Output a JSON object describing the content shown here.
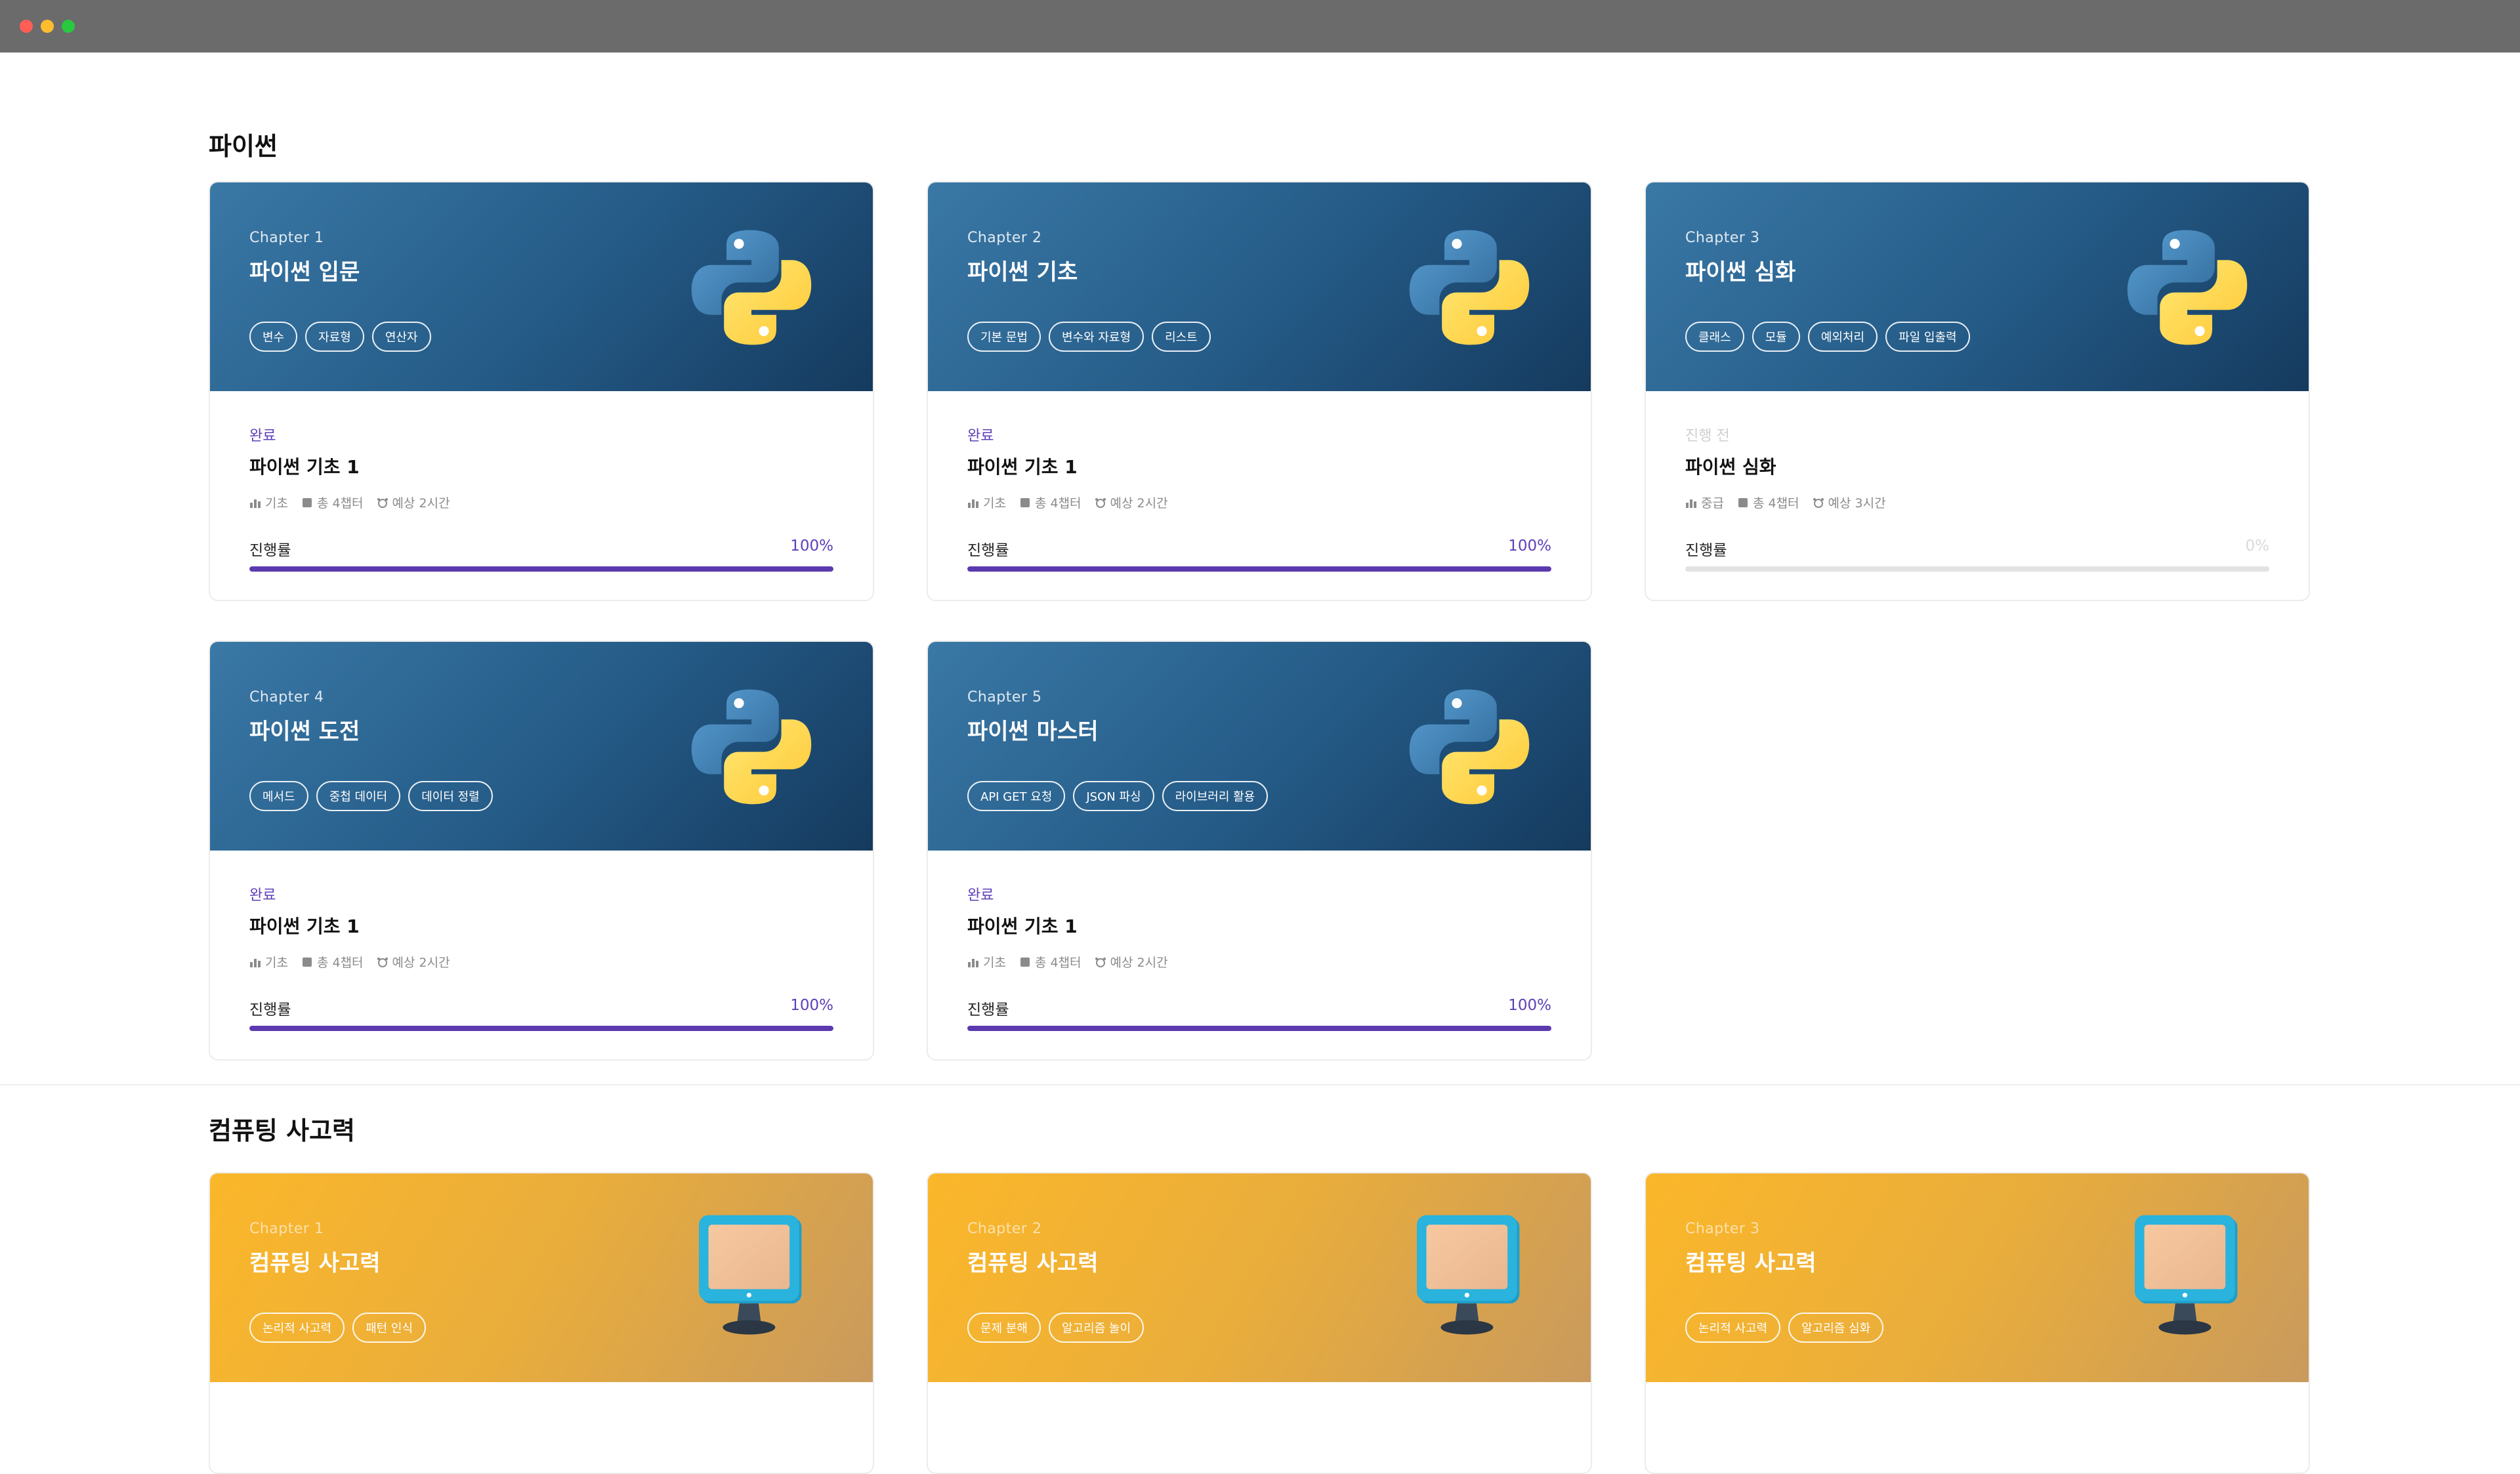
{
  "sections": [
    {
      "title": "파이썬",
      "cards": [
        {
          "chapter": "Chapter 1",
          "title": "파이썬 입문",
          "tags": [
            "변수",
            "자료형",
            "연산자"
          ],
          "status": "완료",
          "body_title": "파이썬 기초 1",
          "level": "기초",
          "chapters": "총 4챕터",
          "time": "예상 2시간",
          "progress_label": "진행률",
          "progress_text": "100%",
          "progress": 1.0
        },
        {
          "chapter": "Chapter 2",
          "title": "파이썬 기초",
          "tags": [
            "기본 문법",
            "변수와 자료형",
            "리스트"
          ],
          "status": "완료",
          "body_title": "파이썬 기초 1",
          "level": "기초",
          "chapters": "총 4챕터",
          "time": "예상 2시간",
          "progress_label": "진행률",
          "progress_text": "100%",
          "progress": 1.0
        },
        {
          "chapter": "Chapter 3",
          "title": "파이썬 심화",
          "tags": [
            "클래스",
            "모듈",
            "예외처리",
            "파일 입출력"
          ],
          "status": "진행 전",
          "body_title": "파이썬 심화",
          "level": "중급",
          "chapters": "총 4챕터",
          "time": "예상 3시간",
          "progress_label": "진행률",
          "progress_text": "0%",
          "progress": 0.0
        },
        {
          "chapter": "Chapter 4",
          "title": "파이썬 도전",
          "tags": [
            "메서드",
            "중첩 데이터",
            "데이터 정렬"
          ],
          "status": "완료",
          "body_title": "파이썬 기초 1",
          "level": "기초",
          "chapters": "총 4챕터",
          "time": "예상 2시간",
          "progress_label": "진행률",
          "progress_text": "100%",
          "progress": 1.0
        },
        {
          "chapter": "Chapter 5",
          "title": "파이썬 마스터",
          "tags": [
            "API GET 요청",
            "JSON 파싱",
            "라이브러리 활용"
          ],
          "status": "완료",
          "body_title": "파이썬 기초 1",
          "level": "기초",
          "chapters": "총 4챕터",
          "time": "예상 2시간",
          "progress_label": "진행률",
          "progress_text": "100%",
          "progress": 1.0
        }
      ]
    },
    {
      "title": "컴퓨팅 사고력",
      "cards": [
        {
          "chapter": "Chapter 1",
          "title": "컴퓨팅 사고력",
          "tags": [
            "논리적 사고력",
            "패턴 인식"
          ]
        },
        {
          "chapter": "Chapter 2",
          "title": "컴퓨팅 사고력",
          "tags": [
            "문제 분해",
            "알고리즘 놀이"
          ]
        },
        {
          "chapter": "Chapter 3",
          "title": "컴퓨팅 사고력",
          "tags": [
            "논리적 사고력",
            "알고리즘 심화"
          ]
        }
      ]
    }
  ],
  "colors": {
    "accent": "#5b3ab0",
    "python_banner": "#2a6292",
    "ct_banner": "#f0b035"
  },
  "icons": {
    "python": "python-logo-icon",
    "computer": "monitor-icon"
  }
}
